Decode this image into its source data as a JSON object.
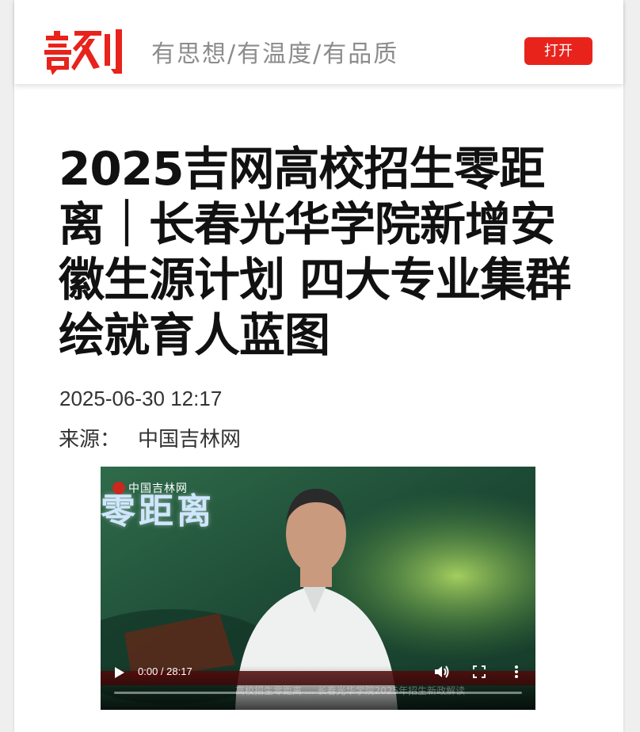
{
  "header": {
    "logo_text": "吉刻",
    "slogan": "有思想/有温度/有品质",
    "open_button": "打开",
    "brand_color": "#e8231c"
  },
  "article": {
    "title": "2025吉网高校招生零距离｜长春光华学院新增安徽生源计划 四大专业集群绘就育人蓝图",
    "date": "2025-06-30 12:17",
    "source_label": "来源：",
    "source_name": "中国吉林网"
  },
  "video": {
    "overlay_title": "零距离",
    "channel_bug": "中国吉林网",
    "current_time": "0:00",
    "duration": "28:17",
    "time_display": "0:00 / 28:17",
    "progress_fraction": 0.0,
    "ticker": "高校招生零距离 … 长春光华学院2025年招生新政解读",
    "icons": [
      "play-icon",
      "volume-icon",
      "fullscreen-icon",
      "more-options-icon"
    ]
  }
}
